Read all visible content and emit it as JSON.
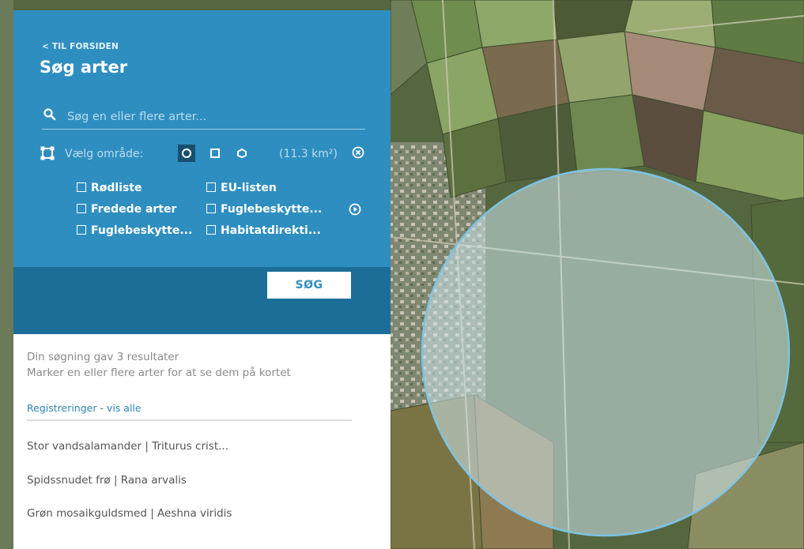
{
  "panel": {
    "back_link": "< TIL FORSIDEN",
    "title": "Søg arter",
    "search": {
      "placeholder": "Søg en eller flere arter..."
    },
    "area": {
      "label": "Vælg område:",
      "shape_options": [
        "circle",
        "square",
        "polygon"
      ],
      "selected_shape": "circle",
      "size": "(11.3 km²)"
    },
    "filters": [
      {
        "label": "Rødliste",
        "checked": false
      },
      {
        "label": "EU-listen",
        "checked": false
      },
      {
        "label": "Fredede arter",
        "checked": false
      },
      {
        "label": "Fuglebeskytte...",
        "checked": false
      },
      {
        "label": "Fuglebeskytte...",
        "checked": false
      },
      {
        "label": "Habitatdirekti...",
        "checked": false
      }
    ],
    "search_button": "SØG"
  },
  "results": {
    "summary": "Din søgning gav 3 resultater",
    "hint": "Marker en eller flere arter for at se dem på kortet",
    "registrations_link": "Registreringer - vis alle",
    "species": [
      "Stor vandsalamander | Triturus crist...",
      "Spidssnudet frø | Rana arvalis",
      "Grøn mosaikguldsmed | Aeshna viridis"
    ]
  },
  "colors": {
    "panel_blue": "#2e8ec0",
    "panel_dark": "#1c6e98",
    "selection_fill": "#cfe7ee",
    "selection_stroke": "#7cc4e4"
  },
  "icons": {
    "search": "search-icon",
    "area": "area-select-icon",
    "clear": "clear-icon",
    "more": "chevron-right-circle-icon"
  }
}
